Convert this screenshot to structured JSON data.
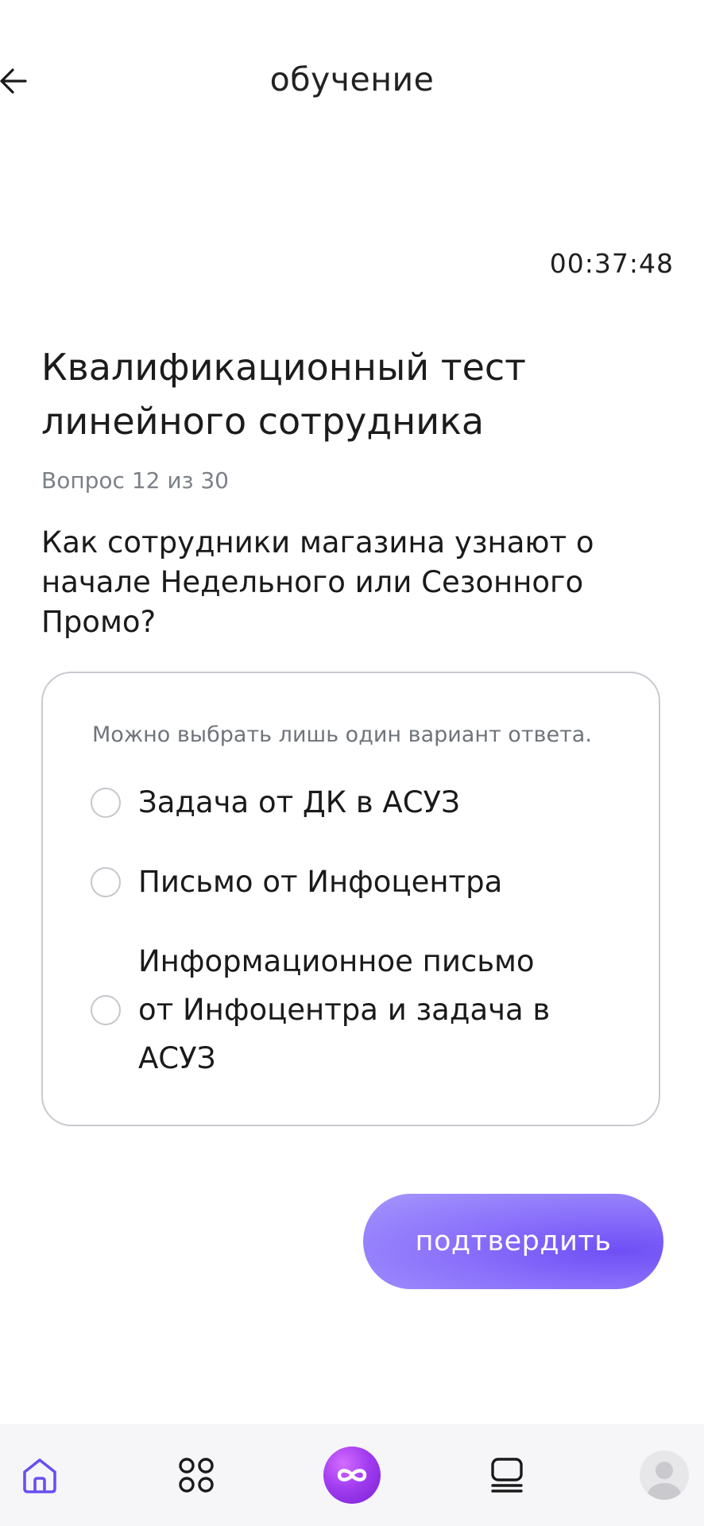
{
  "header": {
    "title": "обучение",
    "back_icon": "arrow-left-icon"
  },
  "timer": "00:37:48",
  "test": {
    "title_line1": "Квалификационный тест",
    "title_line2": "линейного сотрудника",
    "counter": "Вопрос 12 из 30",
    "question": "Как сотрудники магазина узнают о начале Недельного или Сезонного Промо?"
  },
  "answers": {
    "hint": "Можно выбрать лишь один вариант ответа.",
    "options": [
      {
        "label": "Задача от ДК в АСУЗ",
        "selected": false
      },
      {
        "label": "Письмо от Инфоцентра",
        "selected": false
      },
      {
        "label_line1": "Информационное письмо",
        "label_line2": "от Инфоцентра и задача в",
        "label_line3": "АСУЗ",
        "selected": false
      }
    ]
  },
  "confirm_button": {
    "label": "подтвердить"
  },
  "bottom_nav": {
    "items": [
      {
        "icon": "home-icon",
        "active": true
      },
      {
        "icon": "grid-icon",
        "active": false
      },
      {
        "icon": "infinity-icon",
        "active": false
      },
      {
        "icon": "list-icon",
        "active": false
      },
      {
        "icon": "avatar-icon",
        "active": false
      }
    ]
  },
  "colors": {
    "accent": "#7b5cf7",
    "card_border": "#c7cad0",
    "muted_text": "#7c8087",
    "nav_active": "#6a4ff0"
  }
}
